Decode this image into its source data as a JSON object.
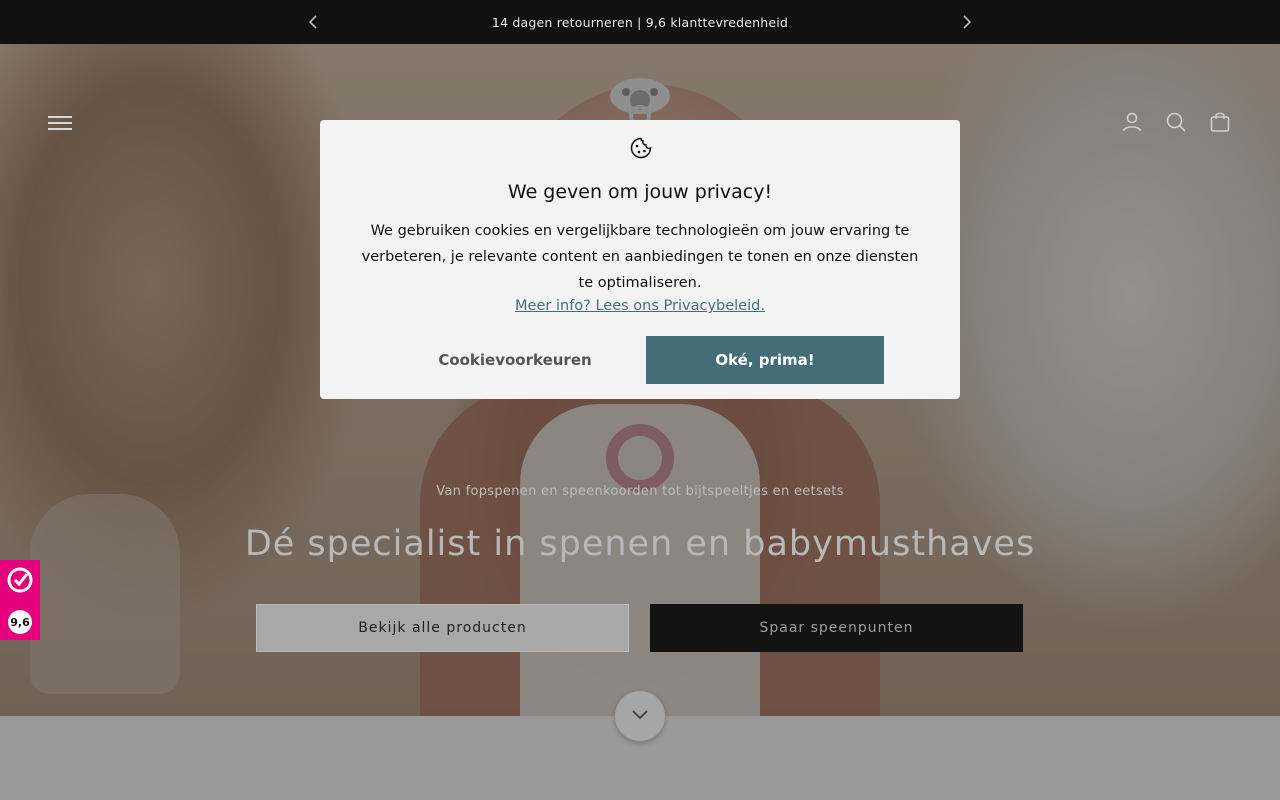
{
  "announcement": {
    "text": "14 dagen retourneren | 9,6 klanttevredenheid",
    "prev_icon": "chevron-left-icon",
    "next_icon": "chevron-right-icon"
  },
  "header": {
    "menu_icon": "hamburger-menu-icon",
    "logo": "pacifier-logo",
    "icons": [
      "account-icon",
      "search-icon",
      "cart-bag-icon"
    ]
  },
  "hero": {
    "subtitle": "Van fopspenen en speenkoorden tot bijtspeeltjes en eetsets",
    "headline": "Dé specialist in spenen en babymusthaves",
    "button_primary": "Bekijk alle producten",
    "button_secondary": "Spaar speenpunten",
    "scroll_icon": "chevron-down-icon"
  },
  "rating_badge": {
    "value": "9,6",
    "brand_color": "#e5007e"
  },
  "cookie_modal": {
    "title": "We geven om jouw privacy!",
    "text": "We gebruiken cookies en vergelijkbare technologieën om jouw ervaring te verbeteren, je relevante content en aanbiedingen te tonen en onze diensten te optimaliseren.",
    "link": "Meer info? Lees ons Privacybeleid.",
    "preferences_button": "Cookievoorkeuren",
    "accept_button": "Oké, prima!",
    "accent_color": "#456d77"
  }
}
